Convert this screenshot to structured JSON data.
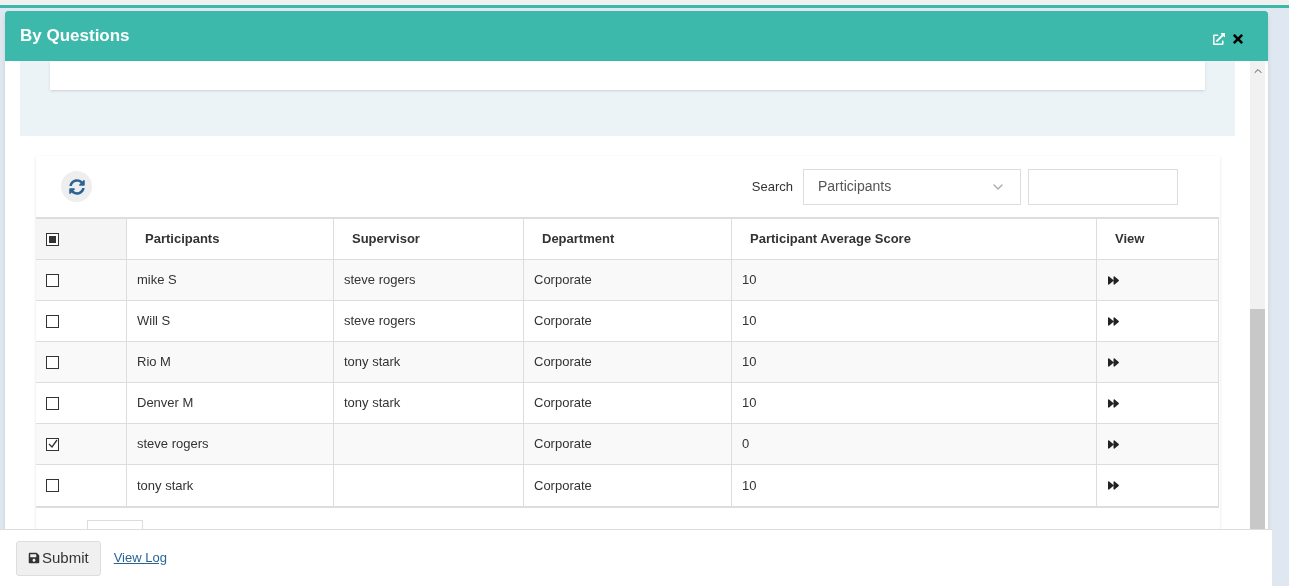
{
  "dialog": {
    "title": "By Questions"
  },
  "toolbar": {
    "search_label": "Search",
    "search_by": "Participants"
  },
  "table": {
    "select_all": {
      "indeterminate": true
    },
    "columns": [
      "Participants",
      "Supervisor",
      "Department",
      "Participant Average Score",
      "View"
    ],
    "rows": [
      {
        "checked": false,
        "participant": "mike S",
        "supervisor": "steve rogers",
        "department": "Corporate",
        "score": "10"
      },
      {
        "checked": false,
        "participant": "Will S",
        "supervisor": "steve rogers",
        "department": "Corporate",
        "score": "10"
      },
      {
        "checked": false,
        "participant": "Rio M",
        "supervisor": "tony stark",
        "department": "Corporate",
        "score": "10"
      },
      {
        "checked": false,
        "participant": "Denver M",
        "supervisor": "tony stark",
        "department": "Corporate",
        "score": "10"
      },
      {
        "checked": true,
        "participant": "steve rogers",
        "supervisor": "",
        "department": "Corporate",
        "score": "0"
      },
      {
        "checked": false,
        "participant": "tony stark",
        "supervisor": "",
        "department": "Corporate",
        "score": "10"
      }
    ]
  },
  "footer": {
    "submit": "Submit",
    "link": "View Log"
  }
}
